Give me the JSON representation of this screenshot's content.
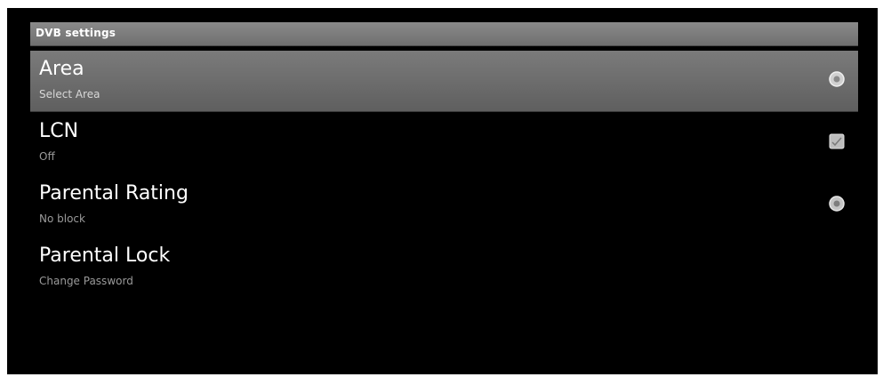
{
  "header": {
    "title": "DVB settings"
  },
  "items": [
    {
      "title": "Area",
      "summary": "Select Area",
      "widget": "radio-icon",
      "selected": true
    },
    {
      "title": "LCN",
      "summary": "Off",
      "widget": "checkbox-icon",
      "selected": false
    },
    {
      "title": "Parental Rating",
      "summary": "No block",
      "widget": "radio-icon",
      "selected": false
    },
    {
      "title": "Parental Lock",
      "summary": "Change Password",
      "widget": "",
      "selected": false
    }
  ],
  "colors": {
    "background": "#000000",
    "header": "#7a7a7a",
    "selected_row": "#6d6d6d",
    "summary_text": "#9a9a9a"
  }
}
